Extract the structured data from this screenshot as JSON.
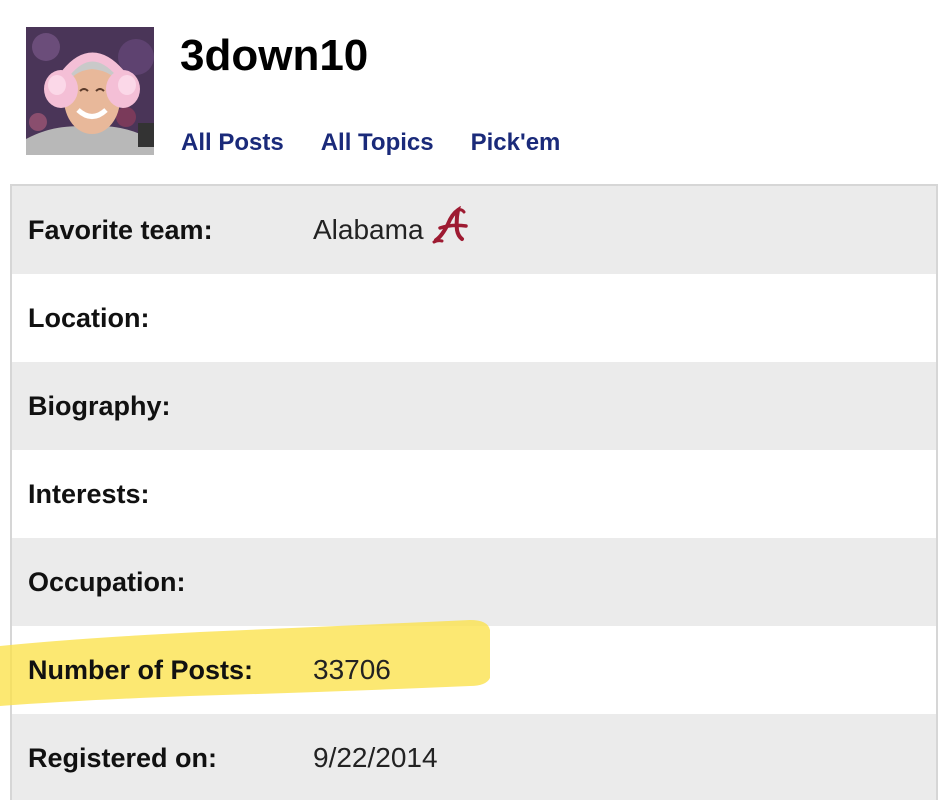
{
  "profile": {
    "username": "3down10",
    "avatar_icon": "user-avatar-photo"
  },
  "nav": {
    "links": [
      "All Posts",
      "All Topics",
      "Pick'em"
    ],
    "color": "#1a2a7a"
  },
  "details": {
    "rows": [
      {
        "label": "Favorite team:",
        "value": "Alabama",
        "logo": "alabama-script-a-logo"
      },
      {
        "label": "Location:",
        "value": ""
      },
      {
        "label": "Biography:",
        "value": ""
      },
      {
        "label": "Interests:",
        "value": ""
      },
      {
        "label": "Occupation:",
        "value": ""
      },
      {
        "label": "Number of Posts:",
        "value": "33706"
      },
      {
        "label": "Registered on:",
        "value": "9/22/2014"
      }
    ]
  },
  "colors": {
    "row_shaded": "#ebebeb",
    "row_plain": "#ffffff",
    "highlight": "#fbe14a",
    "logo": "#9e1b32"
  }
}
